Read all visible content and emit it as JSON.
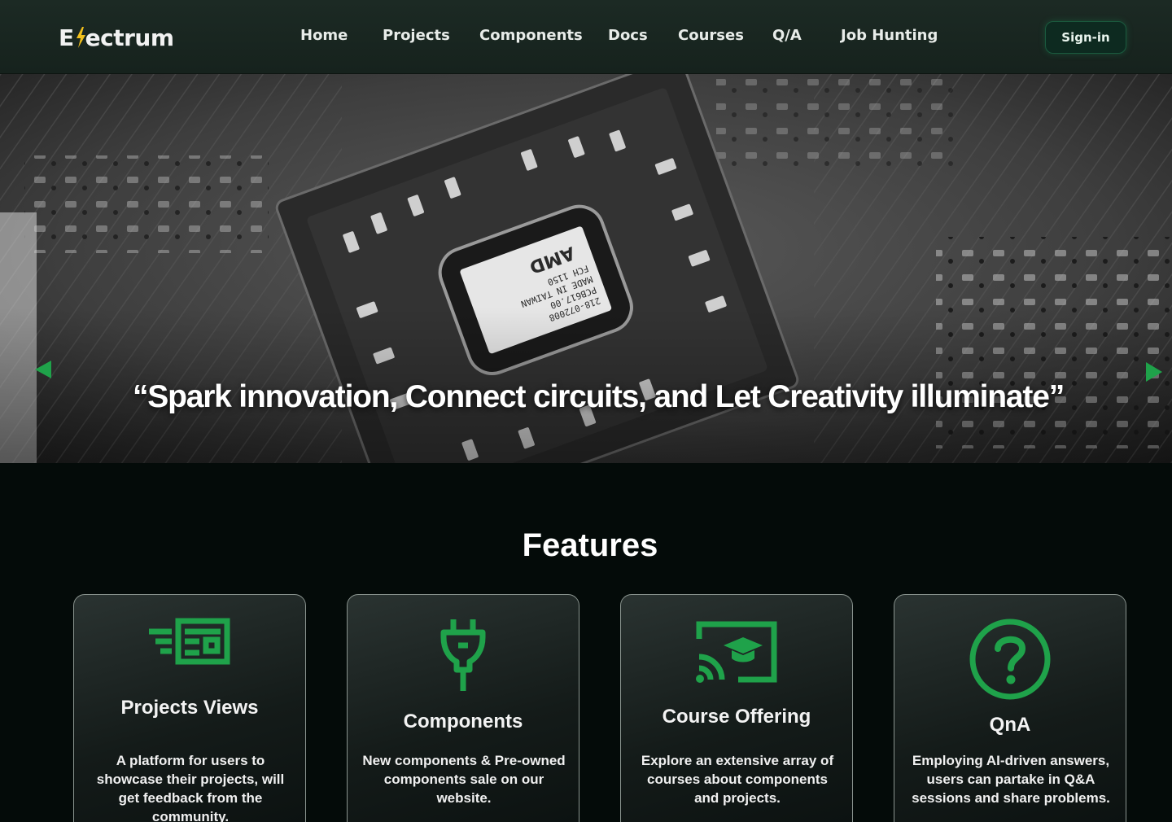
{
  "brand": {
    "logo_prefix": "E",
    "logo_suffix": "ectrum",
    "accent": "#1fa24a",
    "logo_icon": "lightning-bolt-icon"
  },
  "nav": {
    "links": [
      "Home",
      "Projects",
      "Components",
      "Docs",
      "Courses",
      "Q/A",
      "Job Hunting"
    ],
    "signin_label": "Sign-in"
  },
  "hero": {
    "tagline": "“Spark innovation, Connect circuits, and Let Creativity illuminate”",
    "image": "circuit-board-chip-photo",
    "prev_icon": "arrow-left-icon",
    "next_icon": "arrow-right-icon",
    "chip_text": [
      "218-072008",
      "PCB617.00",
      "MADE IN TAIWAN",
      "FCH 1150"
    ],
    "chip_logo": "AMD"
  },
  "features": {
    "title": "Features",
    "cards": [
      {
        "icon": "newspaper-icon",
        "title": "Projects Views",
        "text": "A platform for users to showcase their projects, will get feedback from the community."
      },
      {
        "icon": "plug-icon",
        "title": "Components",
        "text": "New components & Pre-owned components sale on our website."
      },
      {
        "icon": "cast-education-icon",
        "title": "Course Offering",
        "text": "Explore an extensive array of courses about components and projects."
      },
      {
        "icon": "question-circle-icon",
        "title": "QnA",
        "text": "Employing AI-driven answers, users can partake in Q&A sessions and share problems."
      }
    ]
  }
}
